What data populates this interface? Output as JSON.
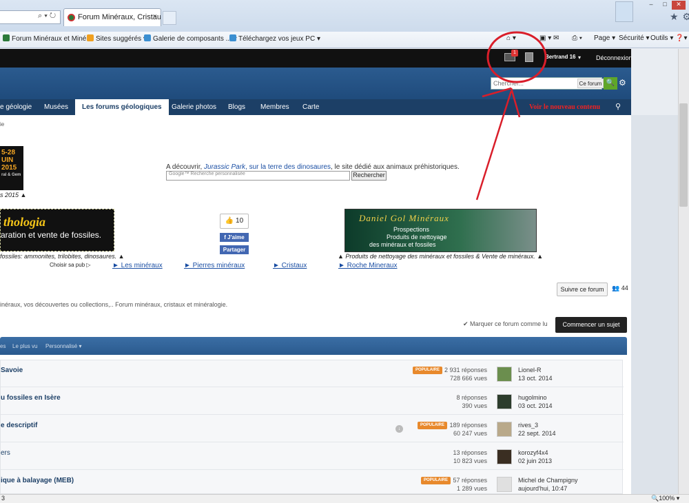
{
  "browser": {
    "tab_title": "Forum Minéraux, Cristaux e...",
    "tab_close": "×",
    "address_icons": "⌕ ▾ ↻",
    "favorites": [
      {
        "label": "Forum Minéraux et Minér...",
        "color": "#2c7a3a"
      },
      {
        "label": "Sites suggérés ▾",
        "color": "#f0a020"
      },
      {
        "label": "Galerie de composants ... ▾",
        "color": "#3b8fd1"
      },
      {
        "label": "Téléchargez vos jeux PC ▾",
        "color": "#3b8fd1"
      }
    ],
    "commands": {
      "page": "Page ▾",
      "security": "Sécurité ▾",
      "tools": "Outils ▾",
      "help": "❓▾"
    },
    "window_buttons": {
      "minimize": "–",
      "maximize": "□",
      "close": "✕"
    },
    "status_left": "3",
    "zoom": "🔍100% ▾"
  },
  "site": {
    "user": {
      "name": "Bertrand 16",
      "notifications": "1",
      "logout": "Déconnexion"
    },
    "search": {
      "placeholder": "Chercher...",
      "scope": "Ce forum",
      "go": "🔍",
      "gear": "⚙"
    },
    "nav": [
      {
        "label": "e géologie"
      },
      {
        "label": "Musées"
      },
      {
        "label": "Les forums géologiques"
      },
      {
        "label": "Galerie photos"
      },
      {
        "label": "Blogs"
      },
      {
        "label": "Membres"
      },
      {
        "label": "Carte"
      }
    ],
    "nav_new": "Voir le nouveau contenu",
    "breadcrumb": "ie",
    "event_banner": {
      "line1": "5-28",
      "line2": "UIN",
      "line3": "2015",
      "line4": "ral & Gem",
      "caption": "s 2015 ▲"
    },
    "promo": {
      "text_prefix": "A découvrir, ",
      "link1": "Jurassic Park",
      "text_mid": ", sur la terre des dinosaures",
      "text_suffix": ", le site dédié aux animaux préhistoriques.",
      "gsearch_placeholder": "Google™ Recherche personnalisée",
      "gsearch_button": "Rechercher"
    },
    "fossil_ad": {
      "title": "thologia",
      "subtitle": "aration et vente de fossiles.",
      "caption": "fossiles: ammonites, trilobites, dinosaures. ▲"
    },
    "social": {
      "likes": "👍 10",
      "like": "f J'aime",
      "share": "Partager"
    },
    "mineral_ad": {
      "title": "Daniel Gol Minéraux",
      "line1": "Prospections",
      "line2": "Produits de nettoyage",
      "line3": "des minéraux et fossiles",
      "caption": "▲ Produits de nettoyage des minéraux et fossiles & Vente de minéraux. ▲"
    },
    "ad_links": {
      "choose": "Choisir sa pub ▷",
      "l1": "► Les minéraux",
      "l2": "► Pierres minéraux",
      "l3": "► Cristaux",
      "l4": "► Roche Mineraux"
    },
    "forum": {
      "follow": "Suivre ce forum",
      "followers": "👥 44",
      "description": "inéraux, vos découvertes ou collections,.. Forum minéraux, cristaux et minéralogie.",
      "mark_read": "✔ Marquer ce forum comme lu",
      "new_topic": "Commencer un sujet"
    },
    "list_tabs": [
      "es",
      "Le plus vu",
      "Personnalisé ▾"
    ],
    "topics": [
      {
        "title": "Savoie",
        "popular": "POPULAIRE",
        "replies": "2 931 réponses",
        "views": "728 666 vues",
        "author": "Lionel-R",
        "date": "13 oct. 2014",
        "avatar_color": "#6b8e4e"
      },
      {
        "title": "u fossiles en Isère",
        "popular": "",
        "replies": "8 réponses",
        "views": "390 vues",
        "author": "hugolmino",
        "date": "03 oct. 2014",
        "avatar_color": "#2d3d2d"
      },
      {
        "title": "e descriptif",
        "popular": "POPULAIRE",
        "replies": "189 réponses",
        "views": "60 247 vues",
        "author": "rives_3",
        "date": "22 sept. 2014",
        "avatar_color": "#b9a98a"
      },
      {
        "title": "ers",
        "popular": "",
        "replies": "13 réponses",
        "views": "10 823 vues",
        "author": "korozyf4x4",
        "date": "02 juin 2013",
        "avatar_color": "#3a2e22"
      },
      {
        "title": "ique à balayage (MEB)",
        "popular": "POPULAIRE",
        "replies": "57 réponses",
        "views": "1 289 vues",
        "author": "Michel de Champigny",
        "date": "aujourd'hui, 10:47",
        "avatar_color": "#e0e0e0"
      }
    ]
  },
  "colors": {
    "annotation": "#d91e2a",
    "nav_bg": "#1c3f66",
    "header_bg": "#2b5b8f",
    "popular": "#e8892c"
  }
}
